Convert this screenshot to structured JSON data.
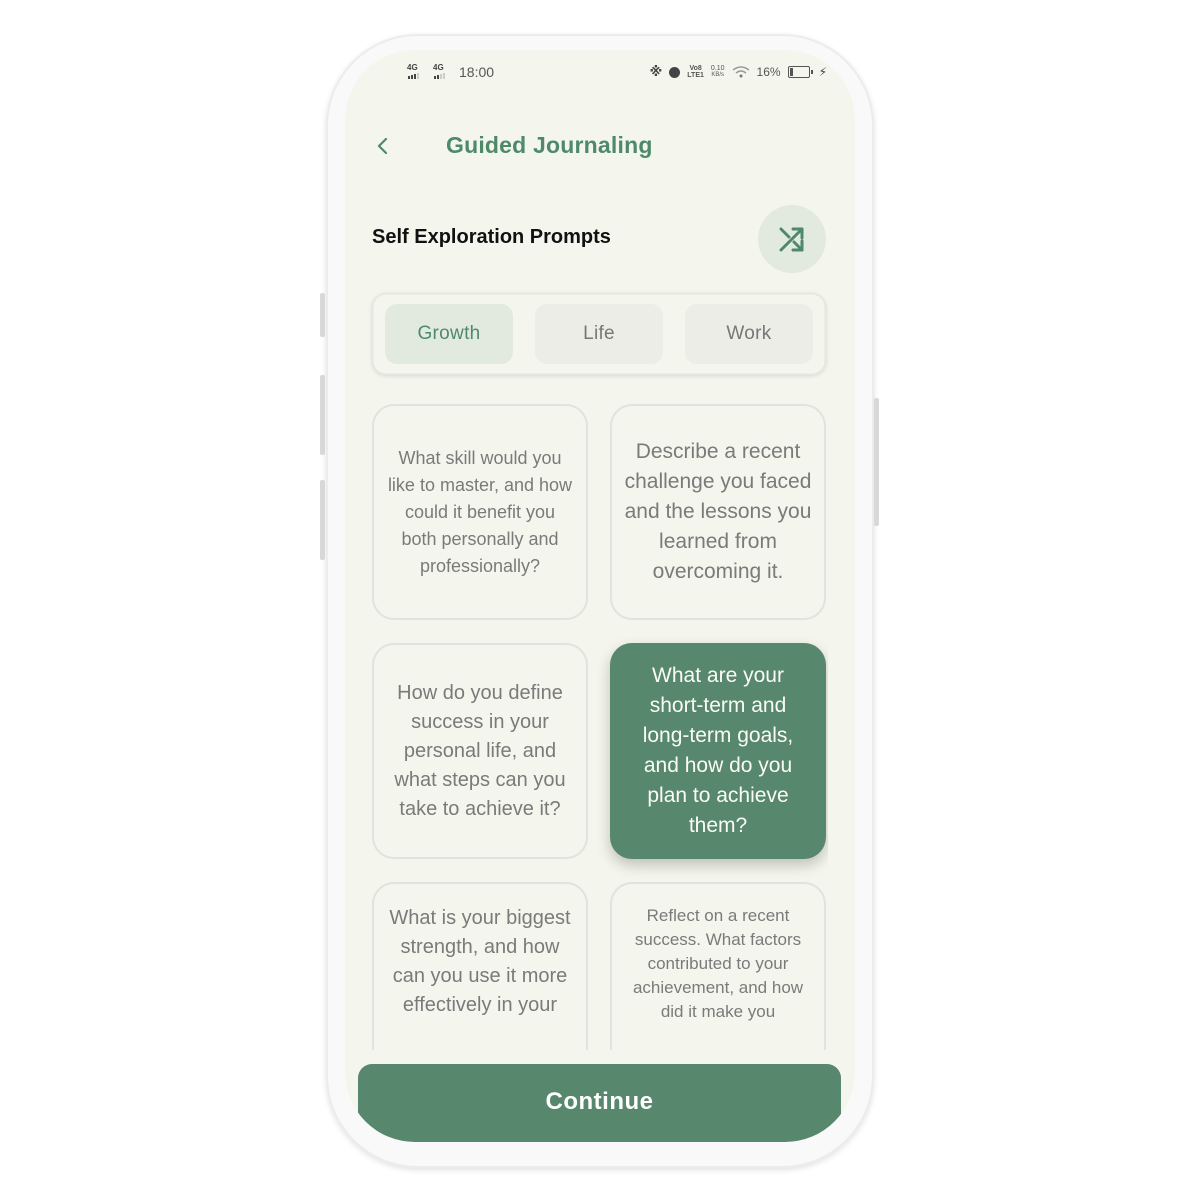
{
  "status_bar": {
    "network_1": "4G",
    "network_2": "4G",
    "time": "18:00",
    "volte_top": "Vo8",
    "volte_bottom": "LTE1",
    "speed_value": "0.10",
    "speed_unit": "KB/s",
    "battery_percent": "16%",
    "battery_level": 0.16,
    "icons": [
      "bluetooth-icon",
      "alarm-icon",
      "wifi-icon",
      "battery-icon",
      "charging-icon"
    ]
  },
  "header": {
    "title": "Guided Journaling",
    "back_icon": "chevron-left-icon"
  },
  "section": {
    "title": "Self Exploration Prompts",
    "shuffle_icon": "shuffle-icon"
  },
  "tabs": [
    {
      "label": "Growth",
      "active": true
    },
    {
      "label": "Life",
      "active": false
    },
    {
      "label": "Work",
      "active": false
    }
  ],
  "prompts": [
    {
      "text": "What skill would you like to master, and how could it benefit you both personally and professionally?",
      "selected": false
    },
    {
      "text": "Describe a recent challenge you faced and the lessons you learned from overcoming it.",
      "selected": false
    },
    {
      "text": "How do you define success in your personal life, and what steps can you take to achieve it?",
      "selected": false
    },
    {
      "text": "What are your short-term and long-term goals, and how do you plan to achieve them?",
      "selected": true
    },
    {
      "text": "What is your biggest strength, and how can you use it more effectively in your",
      "selected": false
    },
    {
      "text": "Reflect on a recent success. What factors contributed to your achievement, and how did it make you",
      "selected": false
    }
  ],
  "continue_button": {
    "label": "Continue"
  },
  "colors": {
    "accent": "#57876c",
    "title_green": "#4e8a69",
    "background": "#f4f6ed",
    "tab_active_bg": "#e2eadf"
  }
}
